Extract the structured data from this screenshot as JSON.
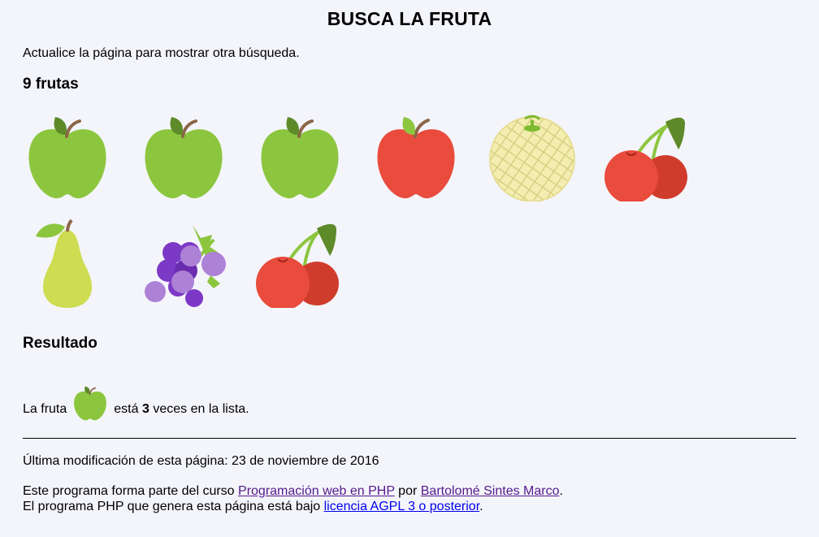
{
  "page_title": "BUSCA LA FRUTA",
  "intro": "Actualice la página para mostrar otra búsqueda.",
  "fruit_count_heading": "9 frutas",
  "fruits": [
    {
      "name": "manzana verde",
      "icon": "green-apple-icon"
    },
    {
      "name": "manzana verde",
      "icon": "green-apple-icon"
    },
    {
      "name": "manzana verde",
      "icon": "green-apple-icon"
    },
    {
      "name": "manzana roja",
      "icon": "red-apple-icon"
    },
    {
      "name": "melón",
      "icon": "melon-icon"
    },
    {
      "name": "cerezas",
      "icon": "cherries-icon"
    },
    {
      "name": "pera",
      "icon": "pear-icon"
    },
    {
      "name": "uvas",
      "icon": "grapes-icon"
    },
    {
      "name": "cerezas",
      "icon": "cherries-icon"
    }
  ],
  "result": {
    "heading": "Resultado",
    "prefix": "La fruta",
    "icon": "green-apple-icon",
    "middle": "está",
    "count": "3",
    "suffix": "veces en la lista."
  },
  "footer": {
    "modified": "Última modificación de esta página: 23 de noviembre de 2016",
    "line1_prefix": "Este programa forma parte del curso",
    "course_link": "Programación web en PHP",
    "line1_by": "por",
    "author_link": "Bartolomé Sintes Marco",
    "line1_end": ".",
    "line2_prefix": "El programa PHP que genera esta página está bajo",
    "license_link": "licencia AGPL 3 o posterior",
    "line2_end": "."
  },
  "colors": {
    "background": "#f4f5fb",
    "green_apple": "#8cc63f",
    "red_apple": "#e94b3c",
    "visited_link": "#551a8b",
    "link": "#0000ee"
  }
}
